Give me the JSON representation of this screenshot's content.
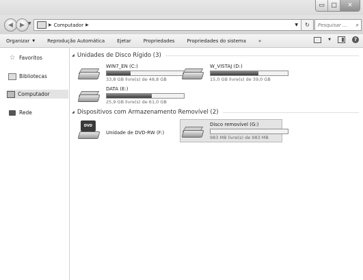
{
  "window": {
    "minimize_glyph": "▭",
    "maximize_glyph": "□",
    "close_glyph": "✕"
  },
  "address": {
    "path_item": "Computador",
    "search_placeholder": "Pesquisar ..."
  },
  "toolbar": {
    "organize": "Organizar",
    "autoplay": "Reprodução Automática",
    "eject": "Ejetar",
    "properties": "Propriedades",
    "system_properties": "Propriedades do sistema",
    "more": "»"
  },
  "sidebar": {
    "items": [
      {
        "label": "Favoritos",
        "icon": "star-icon"
      },
      {
        "label": "Bibliotecas",
        "icon": "library-icon"
      },
      {
        "label": "Computador",
        "icon": "computer-icon",
        "selected": true
      },
      {
        "label": "Rede",
        "icon": "network-icon"
      }
    ]
  },
  "groups": {
    "hard_disks": "Unidades de Disco Rígido (3)",
    "removable": "Dispositivos com Armazenamento Removível (2)"
  },
  "drives": {
    "c": {
      "name": "WIN7_EN (C:)",
      "free_text": "33,8 GB livre(s) de 48,8 GB",
      "used_fraction": 0.31
    },
    "d": {
      "name": "W_VISTAJ (D:)",
      "free_text": "15,0 GB livre(s) de 39,0 GB",
      "used_fraction": 0.62
    },
    "e": {
      "name": "DATA (E:)",
      "free_text": "25,9 GB livre(s) de 61,0 GB",
      "used_fraction": 0.58
    },
    "f": {
      "name": "Unidade de DVD-RW (F:)",
      "icon_text": "DVD"
    },
    "g": {
      "name": "Disco removível (G:)",
      "free_text": "983 MB livre(s) de 983 MB",
      "used_fraction": 0.0
    }
  }
}
